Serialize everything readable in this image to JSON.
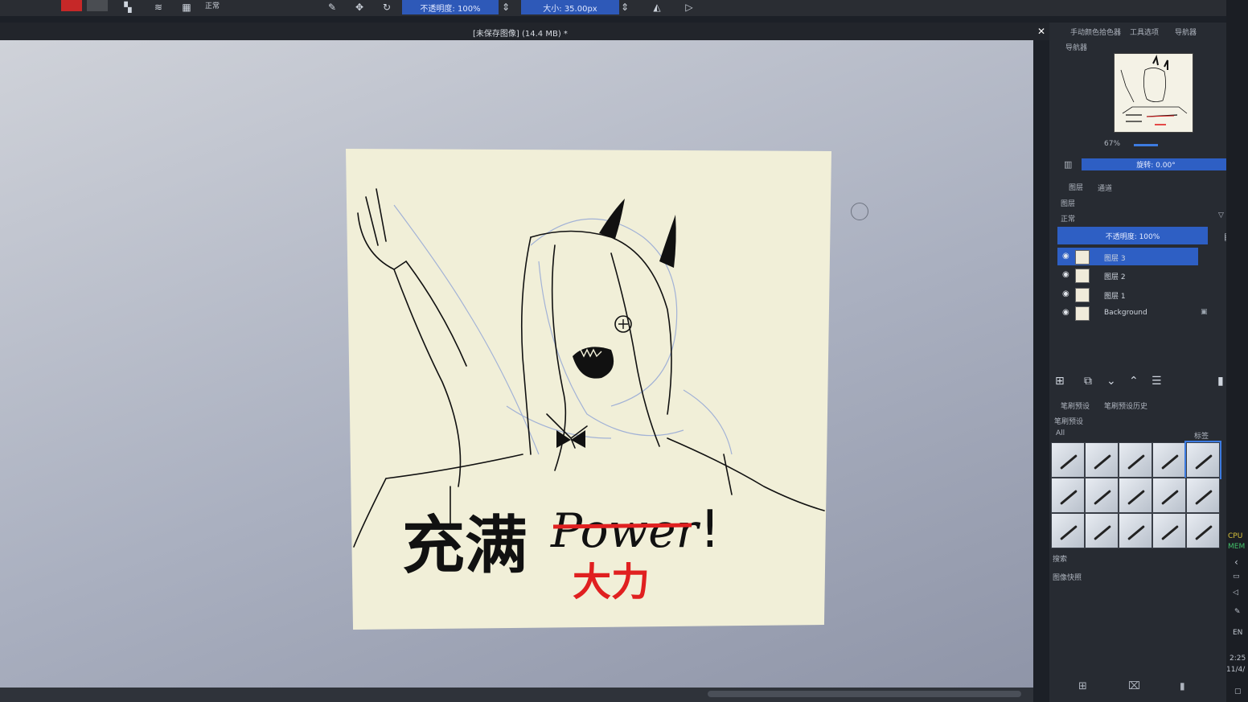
{
  "toolbar": {
    "opacity_field": "不透明度: 100%",
    "size_field": "大小: 35.00px",
    "blend_mode": "正常"
  },
  "document": {
    "title": "[未保存图像] (14.4 MB) *"
  },
  "dock": {
    "tabs": [
      "手动颜色拾色器",
      "工具选项",
      "导航器"
    ],
    "navigator_label": "导航器",
    "zoom": "67%",
    "rotation_field": "旋转: 0.00°",
    "layer_tabs": [
      "图层",
      "通道"
    ],
    "layers_label": "图层",
    "blend_mode": "正常",
    "opacity_field": "不透明度: 100%",
    "layers": [
      {
        "name": "图层 3",
        "active": true
      },
      {
        "name": "图层 2",
        "active": false
      },
      {
        "name": "图层 1",
        "active": false
      },
      {
        "name": "Background",
        "active": false
      }
    ],
    "brush_tabs": [
      "笔刷预设",
      "笔刷预设历史"
    ],
    "brush_presets_label": "笔刷预设",
    "brush_filter": "All",
    "tag_label": "标签",
    "search_label": "搜索",
    "snapshot_label": "图像快照"
  },
  "artwork": {
    "main_text": "充满",
    "struck_word": "Power",
    "exclaim": "!",
    "correction": "大力"
  },
  "system": {
    "cpu": "CPU",
    "mem": "MEM",
    "lang": "EN",
    "time": "2:25",
    "date": "11/4/"
  },
  "colors": {
    "fg": "#c62828",
    "accent": "#2e5fc4",
    "canvas": "#f1efd8"
  }
}
